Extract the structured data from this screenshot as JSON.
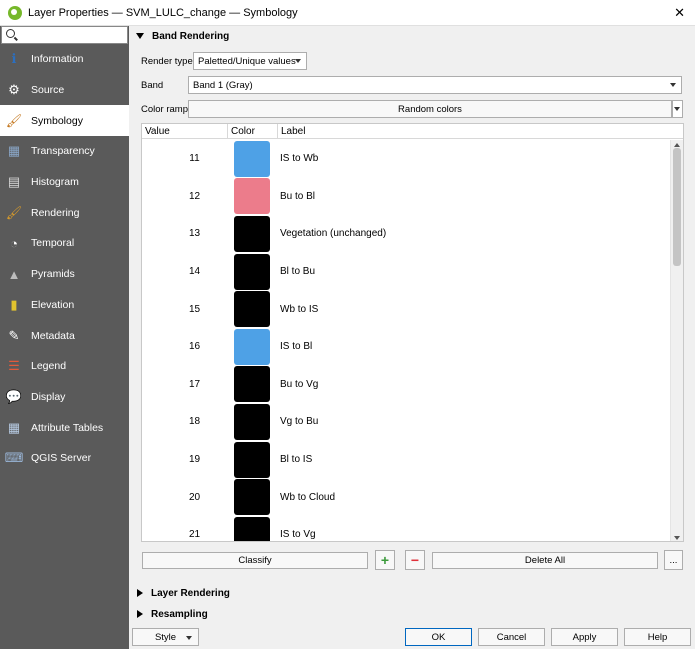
{
  "window": {
    "title": "Layer Properties — SVM_LULC_change — Symbology",
    "close": "✕"
  },
  "sidebar": {
    "search_placeholder": "",
    "items": [
      {
        "label": "Information",
        "icon": "info-icon",
        "glyph": "ℹ",
        "color": "#2c6fbf"
      },
      {
        "label": "Source",
        "icon": "source-icon",
        "glyph": "⚙",
        "color": "#ffffff"
      },
      {
        "label": "Symbology",
        "icon": "symbology-icon",
        "glyph": "🖌",
        "color": "#c4771e"
      },
      {
        "label": "Transparency",
        "icon": "transparency-icon",
        "glyph": "▦",
        "color": "#8aa7c8"
      },
      {
        "label": "Histogram",
        "icon": "histogram-icon",
        "glyph": "▤",
        "color": "#d8d8d8"
      },
      {
        "label": "Rendering",
        "icon": "rendering-icon",
        "glyph": "🖌",
        "color": "#d79a2b"
      },
      {
        "label": "Temporal",
        "icon": "temporal-icon",
        "glyph": "◔",
        "color": "#ffffff"
      },
      {
        "label": "Pyramids",
        "icon": "pyramids-icon",
        "glyph": "▲",
        "color": "#bdbdbd"
      },
      {
        "label": "Elevation",
        "icon": "elevation-icon",
        "glyph": "▮",
        "color": "#e2c32e"
      },
      {
        "label": "Metadata",
        "icon": "metadata-icon",
        "glyph": "✎",
        "color": "#ffffff"
      },
      {
        "label": "Legend",
        "icon": "legend-icon",
        "glyph": "☰",
        "color": "#e25a3a"
      },
      {
        "label": "Display",
        "icon": "display-icon",
        "glyph": "💬",
        "color": "#f2d25c"
      },
      {
        "label": "Attribute Tables",
        "icon": "attribute-tables-icon",
        "glyph": "▦",
        "color": "#b7cbe3"
      },
      {
        "label": "QGIS Server",
        "icon": "qgis-server-icon",
        "glyph": "⌨",
        "color": "#9ab6d8"
      }
    ],
    "active_index": 2
  },
  "band_rendering": {
    "header": "Band Rendering",
    "render_type_label": "Render type",
    "render_type_value": "Paletted/Unique values",
    "band_label": "Band",
    "band_value": "Band 1 (Gray)",
    "color_ramp_label": "Color ramp",
    "color_ramp_value": "Random colors"
  },
  "table": {
    "headers": [
      "Value",
      "Color",
      "Label"
    ],
    "rows": [
      {
        "value": "11",
        "color": "#4ea1e6",
        "label": "IS to Wb"
      },
      {
        "value": "12",
        "color": "#ec7c8b",
        "label": "Bu to Bl"
      },
      {
        "value": "13",
        "color": "#000000",
        "label": "Vegetation (unchanged)"
      },
      {
        "value": "14",
        "color": "#000000",
        "label": "Bl to Bu"
      },
      {
        "value": "15",
        "color": "#000000",
        "label": "Wb to IS"
      },
      {
        "value": "16",
        "color": "#4ea1e6",
        "label": "IS to Bl"
      },
      {
        "value": "17",
        "color": "#000000",
        "label": "Bu to Vg"
      },
      {
        "value": "18",
        "color": "#000000",
        "label": "Vg to Bu"
      },
      {
        "value": "19",
        "color": "#000000",
        "label": "Bl to IS"
      },
      {
        "value": "20",
        "color": "#000000",
        "label": "Wb to Cloud"
      },
      {
        "value": "21",
        "color": "#000000",
        "label": "IS to Vg"
      }
    ]
  },
  "actions": {
    "classify": "Classify",
    "add_symbol": "+",
    "remove_symbol": "−",
    "delete_all": "Delete All",
    "more": "..."
  },
  "sections": {
    "layer_rendering": "Layer Rendering",
    "resampling": "Resampling"
  },
  "footer": {
    "style": "Style",
    "ok": "OK",
    "cancel": "Cancel",
    "apply": "Apply",
    "help": "Help"
  }
}
